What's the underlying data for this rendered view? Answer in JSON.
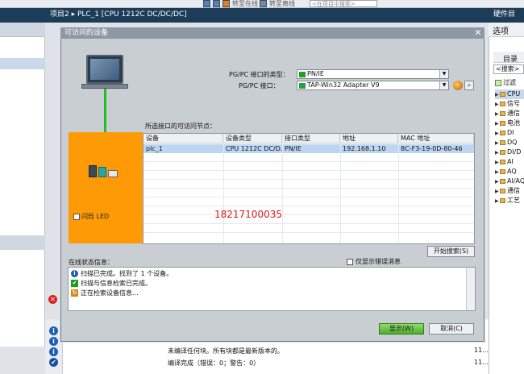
{
  "toolbar": {
    "go_online_label": "转至在线",
    "go_offline_label": "转至离线",
    "search_placeholder": "<在项目中搜索>"
  },
  "header": {
    "project_title": "项目2 ▸ PLC_1 [CPU 1212C DC/DC/DC]",
    "right_panel_title": "硬件目"
  },
  "catalog": {
    "options_label": "选项",
    "catalog_label": "目录",
    "search_value": "<搜索>",
    "filter_label": "过滤",
    "items": [
      "CPU",
      "信号",
      "通信",
      "电池",
      "DI",
      "DQ",
      "DI/D",
      "AI",
      "AQ",
      "AI/AQ",
      "通信",
      "工艺"
    ]
  },
  "dialog": {
    "title": "可访问的设备",
    "close_glyph": "✕",
    "pgpc_type_label": "PG/PC 接口的类型：",
    "pgpc_type_value": "PN/IE",
    "pgpc_iface_label": "PG/PC 接口：",
    "pgpc_iface_value": "TAP-Win32 Adapter V9",
    "flash_led_label": "闪烁 LED",
    "nodes_label": "所选接口的可访问节点：",
    "table": {
      "headers": [
        "设备",
        "设备类型",
        "接口类型",
        "地址",
        "MAC 地址"
      ],
      "rows": [
        [
          "plc_1",
          "CPU 1212C DC/D...",
          "PN/IE",
          "192.168.1.10",
          "8C-F3-19-0D-80-46"
        ]
      ]
    },
    "start_search_label": "开始搜索(S)",
    "status_label": "在线状态信息：",
    "errors_only_label": "仅显示错误消息",
    "status_messages": [
      "扫描已完成。找到了 1 个设备。",
      "扫描与信息检索已完成。",
      "正在检索设备信息..."
    ],
    "ok_label": "显示(W)",
    "cancel_label": "取消(C)"
  },
  "watermark": {
    "phone": "18217100035"
  },
  "bottom": {
    "messages": [
      "未编译任何块。所有块都是最新版本的。",
      "编译完成（错误：0；警告：0）"
    ],
    "times": [
      "11...",
      "11..."
    ]
  },
  "colors": {
    "accent_orange": "#ff9a07",
    "link_green": "#1fc01f",
    "title_navy": "#1d3c58",
    "watermark_red": "#e01818"
  }
}
